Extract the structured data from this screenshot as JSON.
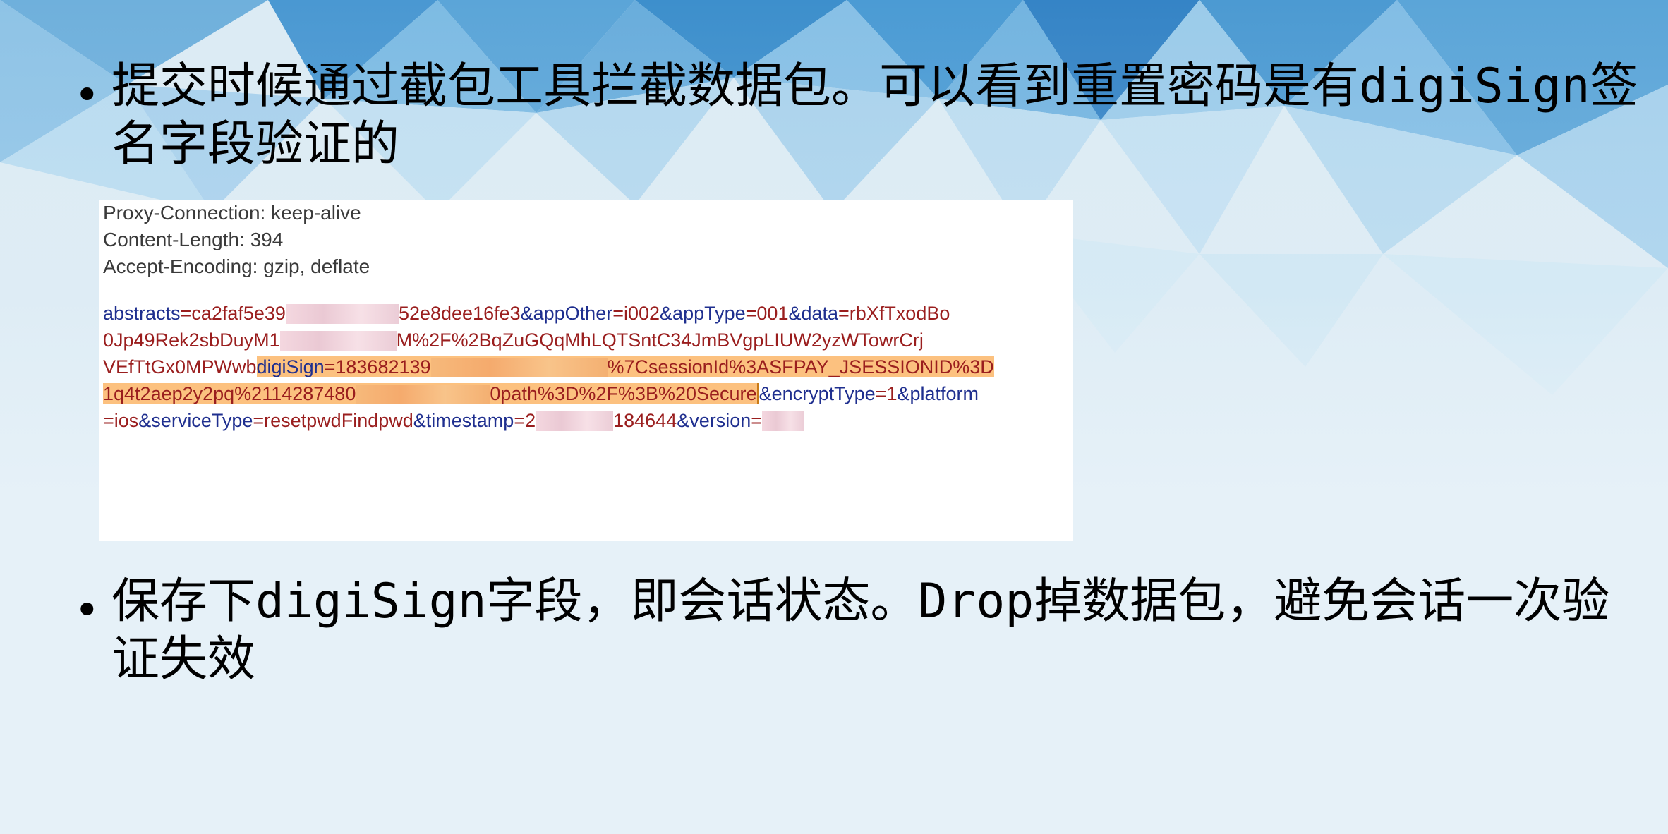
{
  "slide": {
    "bullet1": "提交时候通过截包工具拦截数据包。可以看到重置密码是有digiSign签名字段验证的",
    "bullet2": "保存下digiSign字段，即会话状态。Drop掉数据包，避免会话一次验证失效",
    "bullet_glyph": "•"
  },
  "screenshot": {
    "headers": [
      "Proxy-Connection: keep-alive",
      "Content-Length: 394",
      "Accept-Encoding: gzip, deflate"
    ],
    "body": {
      "l1a": "abstracts",
      "l1b": "=ca2faf5e39",
      "l1c": "52e8dee16fe3",
      "l1d": "&appOther",
      "l1e": "=i002",
      "l1f": "&appType",
      "l1g": "=001",
      "l1h": "&data",
      "l1i": "=rbXfTxodBo",
      "l2a": "0Jp49Rek2sbDuyM1",
      "l2b": "M%2F%2BqZuGQqMhLQTSntC34JmBVgpLIUW2yzWTowrCrj",
      "l3a": "VEfTtGx0MPWwb",
      "l3b": "digiSign",
      "l3c": "=183682139",
      "l3d": "%7CsessionId%3ASFPAY_JSESSIONID%3D",
      "l4a": "1q4t2aep2y2pq%2114287480",
      "l4b": "0path%3D%2F%3B%20Secure",
      "l4c": "&encryptType",
      "l4d": "=1",
      "l4e": "&platform",
      "l5a": "=ios",
      "l5b": "&serviceType",
      "l5c": "=resetpwdFindpwd",
      "l5d": "&timestamp",
      "l5e": "=2",
      "l5f": "184644",
      "l5g": "&version",
      "l5h": "="
    }
  },
  "colors": {
    "param": "#1f2f8f",
    "value": "#9a1e1e",
    "highlight": "#fcc17f"
  }
}
